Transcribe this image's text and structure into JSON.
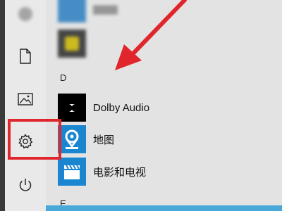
{
  "start_menu": {
    "rail": {
      "items": [
        {
          "name": "document-icon",
          "label": ""
        },
        {
          "name": "pictures-icon",
          "label": ""
        },
        {
          "name": "settings-icon",
          "label": ""
        },
        {
          "name": "power-icon",
          "label": ""
        }
      ]
    },
    "sections": {
      "d_letter": "D",
      "e_letter": "E"
    },
    "apps": [
      {
        "label": "Dolby Audio",
        "tile_color": "#000000"
      },
      {
        "label": "地图",
        "tile_color": "#1a86d0"
      },
      {
        "label": "电影和电视",
        "tile_color": "#1a86d0"
      }
    ]
  },
  "annotation": {
    "highlight_color": "#e0262c"
  }
}
